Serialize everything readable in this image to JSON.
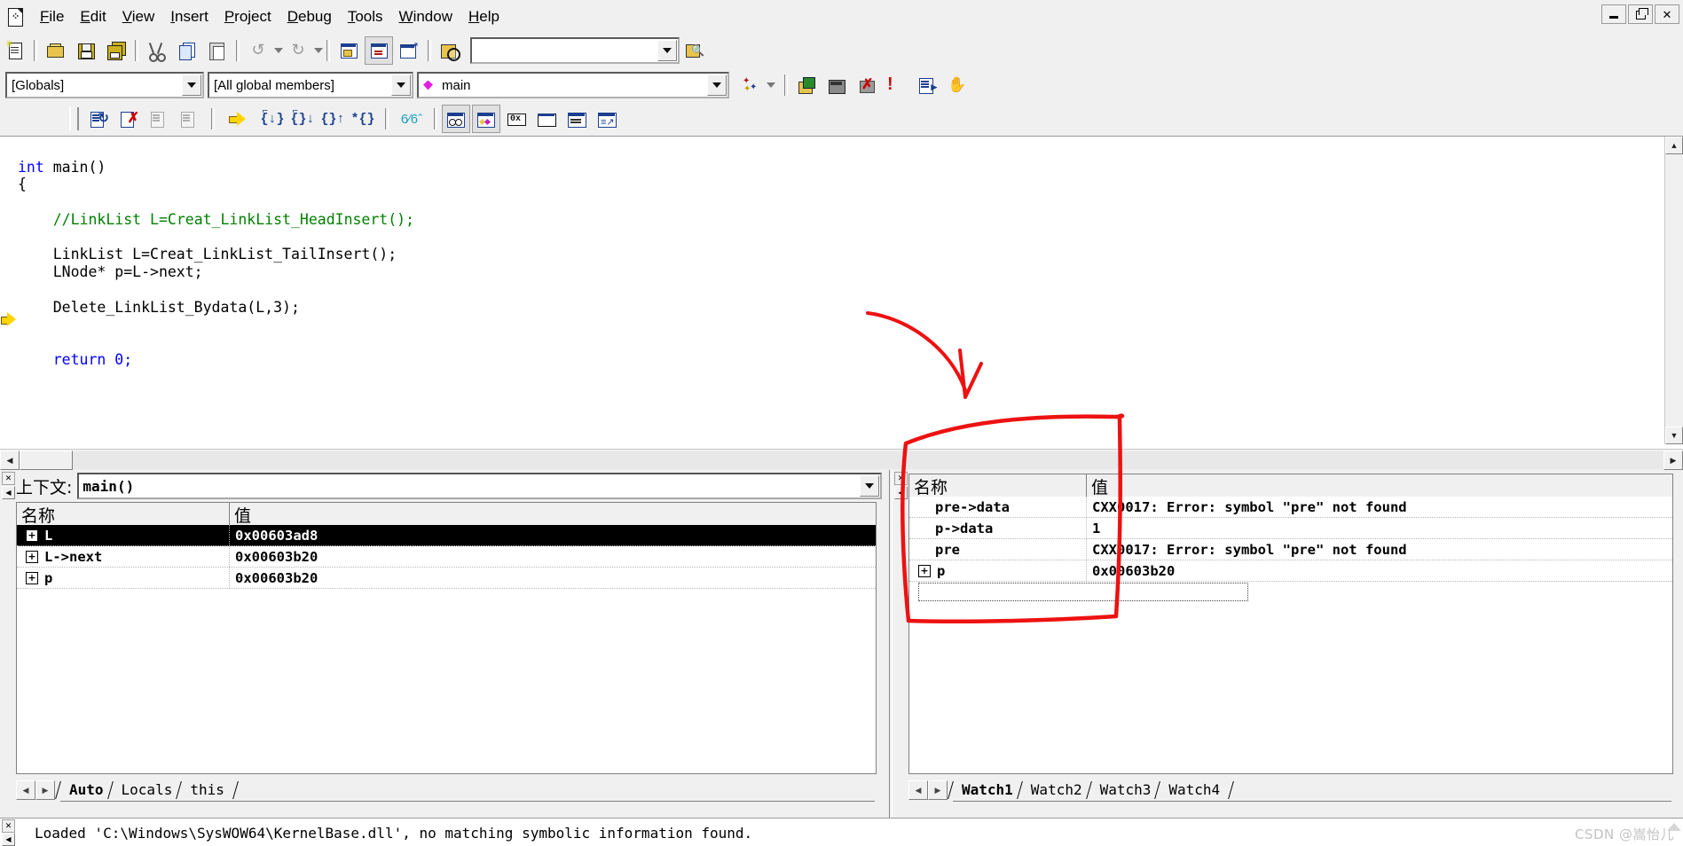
{
  "window": {
    "minimize_label": "_",
    "restore_label": "❐",
    "close_label": "✕"
  },
  "menubar": {
    "app_icon": "new-document-icon",
    "items": [
      {
        "label": "File",
        "accel": "F"
      },
      {
        "label": "Edit",
        "accel": "E"
      },
      {
        "label": "View",
        "accel": "V"
      },
      {
        "label": "Insert",
        "accel": "I"
      },
      {
        "label": "Project",
        "accel": "P"
      },
      {
        "label": "Debug",
        "accel": "D"
      },
      {
        "label": "Tools",
        "accel": "T"
      },
      {
        "label": "Window",
        "accel": "W"
      },
      {
        "label": "Help",
        "accel": "H"
      }
    ]
  },
  "standard_toolbar": {
    "buttons": [
      "new-text-file-icon",
      "open-icon",
      "save-icon",
      "save-all-icon",
      "cut-icon",
      "copy-icon",
      "paste-icon",
      "undo-icon",
      "redo-icon",
      "workspace-icon",
      "output-window-icon",
      "workspace-window-icon",
      "find-in-files-icon"
    ],
    "find_box_value": "",
    "find_box_placeholder": "",
    "find_match_icon": "find-match-icon"
  },
  "wizardbar": {
    "scope_combo": "[Globals]",
    "members_combo": "[All global members]",
    "symbol_combo": "main",
    "symbol_icon": "diamond-member-icon",
    "buttons": [
      "wizard-icon",
      "compile-icon",
      "build-icon",
      "stop-build-icon",
      "execute-icon",
      "go-icon",
      "hand-icon"
    ]
  },
  "debug_toolbar": {
    "buttons": [
      "restart-icon",
      "stop-debugging-icon",
      "break-execution-icon",
      "apply-code-changes-icon",
      "show-next-statement-icon",
      "step-into-icon",
      "step-over-icon",
      "step-out-icon",
      "run-to-cursor-icon",
      "quickwatch-icon",
      "watch-window-icon",
      "variables-window-icon",
      "registers-window-icon",
      "memory-window-icon",
      "callstack-window-icon",
      "disassembly-window-icon"
    ]
  },
  "editor": {
    "breakpoint_marker": "current-statement-arrow",
    "lines": [
      [
        {
          "t": "int",
          "c": "kw"
        },
        {
          "t": " main()",
          "c": ""
        }
      ],
      [
        {
          "t": "{",
          "c": ""
        }
      ],
      [
        {
          "t": "",
          "c": ""
        }
      ],
      [
        {
          "t": "    //LinkList L=Creat_LinkList_HeadInsert();",
          "c": "cmt"
        }
      ],
      [
        {
          "t": "",
          "c": ""
        }
      ],
      [
        {
          "t": "    LinkList L=Creat_LinkList_TailInsert();",
          "c": ""
        }
      ],
      [
        {
          "t": "    LNode* p=L->next;",
          "c": ""
        }
      ],
      [
        {
          "t": "",
          "c": ""
        }
      ],
      [
        {
          "t": "    Delete_LinkList_Bydata(L,3);",
          "c": ""
        }
      ],
      [
        {
          "t": "",
          "c": ""
        }
      ],
      [
        {
          "t": "",
          "c": ""
        }
      ],
      [
        {
          "t": "    ",
          "c": ""
        },
        {
          "t": "return",
          "c": "kw"
        },
        {
          "t": " ",
          "c": ""
        },
        {
          "t": "0;",
          "c": "kw"
        }
      ]
    ]
  },
  "variables_pane": {
    "close_icon": "close-pane-icon",
    "scroll_icon": "scroll-left-icon",
    "context_label": "上下文:",
    "context_value": "main()",
    "columns": [
      "名称",
      "值"
    ],
    "rows": [
      {
        "expander": "+",
        "name": "L",
        "value": "0x00603ad8",
        "selected": true
      },
      {
        "expander": "+",
        "name": "L->next",
        "value": "0x00603b20",
        "selected": false
      },
      {
        "expander": "+",
        "name": "p",
        "value": "0x00603b20",
        "selected": false
      }
    ],
    "tabs": [
      {
        "label": "Auto",
        "active": true
      },
      {
        "label": "Locals",
        "active": false
      },
      {
        "label": "this",
        "active": false
      }
    ]
  },
  "watch_pane": {
    "close_icon": "close-pane-icon",
    "scroll_icon": "scroll-left-icon",
    "columns": [
      "名称",
      "值"
    ],
    "rows": [
      {
        "expander": "",
        "name": "pre->data",
        "value": "CXX0017: Error: symbol \"pre\" not found"
      },
      {
        "expander": "",
        "name": "p->data",
        "value": "1"
      },
      {
        "expander": "",
        "name": "pre",
        "value": "CXX0017: Error: symbol \"pre\" not found"
      },
      {
        "expander": "+",
        "name": "p",
        "value": "0x00603b20"
      }
    ],
    "tabs": [
      {
        "label": "Watch1",
        "active": true
      },
      {
        "label": "Watch2",
        "active": false
      },
      {
        "label": "Watch3",
        "active": false
      },
      {
        "label": "Watch4",
        "active": false
      }
    ]
  },
  "output_bar": {
    "close_icon": "close-pane-icon",
    "scroll_icon": "scroll-left-icon",
    "message": "Loaded 'C:\\Windows\\SysWOW64\\KernelBase.dll', no matching symbolic information found."
  },
  "watermark": {
    "text": "CSDN @嵩怡儿"
  },
  "annotation": {
    "color": "#ee1111",
    "shapes": [
      "curved-arrow-pointing-down",
      "hand-drawn-rectangle-around-watch-list"
    ]
  }
}
